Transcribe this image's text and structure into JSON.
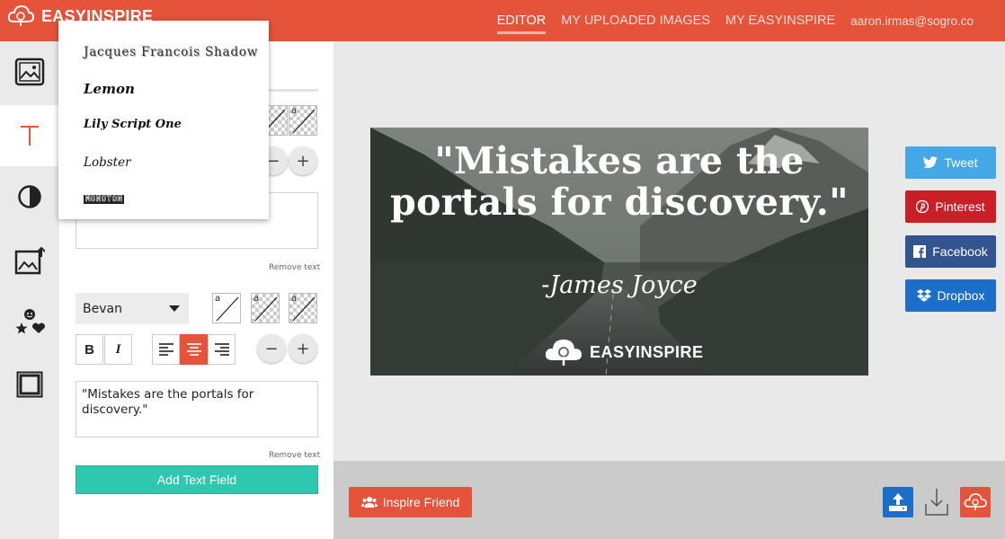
{
  "app": {
    "brand": "EASYINSPIRE",
    "accent_color": "#e4533a",
    "teal_color": "#2ec8b0"
  },
  "nav": {
    "items": [
      "EDITOR",
      "MY UPLOADED IMAGES",
      "MY EASYINSPIRE"
    ],
    "active": "EDITOR",
    "user_email": "aaron.irmas@sogro.co"
  },
  "rail": {
    "items": [
      {
        "icon": "image-icon"
      },
      {
        "icon": "text-icon",
        "active": true
      },
      {
        "icon": "contrast-icon"
      },
      {
        "icon": "upload-image-icon"
      },
      {
        "icon": "stickers-icon"
      },
      {
        "icon": "frame-icon"
      }
    ]
  },
  "font_dropdown": {
    "options": [
      "Jacques Francois Shadow",
      "Lemon",
      "Lily Script One",
      "Lobster",
      "Monoton"
    ]
  },
  "text_field_1": {
    "value": "",
    "remove_label": "Remove text"
  },
  "text_field_2": {
    "font": "Bevan",
    "value": "\"Mistakes are the portals for discovery.\"",
    "remove_label": "Remove text",
    "bold_label": "B",
    "italic_label": "I",
    "alignment": "center"
  },
  "add_text_label": "Add Text Field",
  "canvas": {
    "quote": "\"Mistakes are the portals for discovery.\"",
    "author": "-James Joyce",
    "watermark": "EASYINSPIRE"
  },
  "share": {
    "tweet": "Tweet",
    "pinterest": "Pinterest",
    "facebook": "Facebook",
    "dropbox": "Dropbox",
    "colors": {
      "tweet": "#45a8e6",
      "pinterest": "#cb1f27",
      "facebook": "#33558f",
      "dropbox": "#1b6fcb"
    }
  },
  "bottom": {
    "inspire_label": "Inspire Friend"
  }
}
